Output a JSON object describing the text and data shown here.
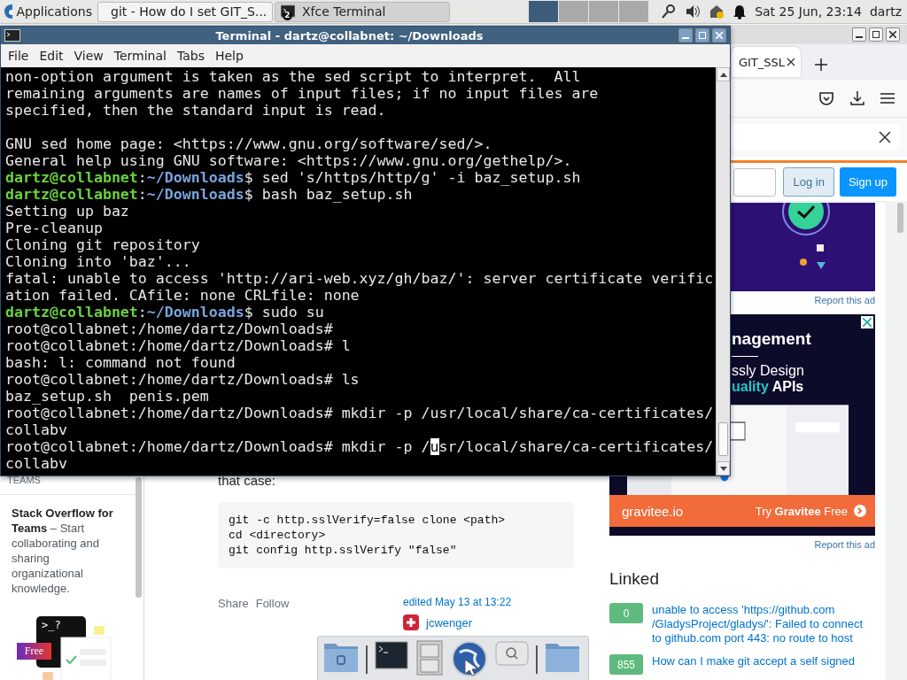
{
  "panel": {
    "app_menu": "Applications",
    "tasks": [
      {
        "kind": "browser",
        "label": "git - How do I set GIT_S...",
        "selected": false
      },
      {
        "kind": "terminal",
        "label": "Xfce Terminal",
        "badge": "2",
        "selected": true
      }
    ],
    "workspaces": [
      {
        "selected": true
      },
      {
        "selected": false
      },
      {
        "selected": false
      },
      {
        "selected": false
      }
    ],
    "clock": "Sat 25 Jun, 23:14",
    "user": "dartz"
  },
  "terminal": {
    "title": "Terminal - dartz@collabnet: ~/Downloads",
    "menu": [
      "File",
      "Edit",
      "View",
      "Terminal",
      "Tabs",
      "Help"
    ],
    "lines": [
      {
        "kind": "text",
        "text": "non-option argument is taken as the sed script to interpret.  All"
      },
      {
        "kind": "text",
        "text": "remaining arguments are names of input files; if no input files are"
      },
      {
        "kind": "text",
        "text": "specified, then the standard input is read."
      },
      {
        "kind": "blank"
      },
      {
        "kind": "text",
        "text": "GNU sed home page: <https://www.gnu.org/software/sed/>."
      },
      {
        "kind": "text",
        "text": "General help using GNU software: <https://www.gnu.org/gethelp/>."
      },
      {
        "kind": "prompt",
        "user": "dartz@collabnet",
        "sep": ":",
        "path": "~/Downloads",
        "command": "$ sed 's/https/http/g' -i baz_setup.sh"
      },
      {
        "kind": "prompt",
        "user": "dartz@collabnet",
        "sep": ":",
        "path": "~/Downloads",
        "command": "$ bash baz_setup.sh"
      },
      {
        "kind": "text",
        "text": "Setting up baz"
      },
      {
        "kind": "text",
        "text": "Pre-cleanup"
      },
      {
        "kind": "text",
        "text": "Cloning git repository"
      },
      {
        "kind": "text",
        "text": "Cloning into 'baz'..."
      },
      {
        "kind": "text",
        "text": "fatal: unable to access 'http://ari-web.xyz/gh/baz/': server certificate verific"
      },
      {
        "kind": "text",
        "text": "ation failed. CAfile: none CRLfile: none"
      },
      {
        "kind": "prompt",
        "user": "dartz@collabnet",
        "sep": ":",
        "path": "~/Downloads",
        "command": "$ sudo su"
      },
      {
        "kind": "text",
        "text": "root@collabnet:/home/dartz/Downloads#"
      },
      {
        "kind": "text",
        "text": "root@collabnet:/home/dartz/Downloads# l"
      },
      {
        "kind": "text",
        "text": "bash: l: command not found"
      },
      {
        "kind": "text",
        "text": "root@collabnet:/home/dartz/Downloads# ls"
      },
      {
        "kind": "text",
        "text": "baz_setup.sh  penis.pem"
      },
      {
        "kind": "text",
        "text": "root@collabnet:/home/dartz/Downloads# mkdir -p /usr/local/share/ca-certificates/"
      },
      {
        "kind": "text",
        "text": "collabv"
      },
      {
        "kind": "cursor",
        "before": "root@collabnet:/home/dartz/Downloads# mkdir -p /",
        "cursor": "u",
        "after": "sr/local/share/ca-certificates/"
      },
      {
        "kind": "text",
        "text": "collabv"
      }
    ]
  },
  "browser": {
    "tab": {
      "label": "GIT_SSL"
    },
    "auth": {
      "login": "Log in",
      "signup": "Sign up"
    },
    "sidebar": {
      "section": "TEAMS",
      "promo": "**Stack Overflow for Teams** – Start collaborating and sharing organizational knowledge.",
      "prompt": ">_?",
      "badge": "Free"
    },
    "answer": {
      "intro": "that case:",
      "code": [
        "git -c http.sslVerify=false clone <path>",
        "cd <directory>",
        "git config http.sslVerify \"false\""
      ],
      "actions": [
        "Share",
        "Follow"
      ],
      "edited": "edited May 13 at 13:22",
      "user": "jcwenger"
    },
    "ads": [
      {
        "kind": "picture",
        "report": "Report this ad"
      },
      {
        "kind": "banner",
        "heading": "nagement",
        "line": "ssly Design",
        "highlight": "uality",
        "rest": "APIs",
        "brand": "gravitee.io",
        "cta": "Try **Gravitee** Free",
        "report": "Report this ad"
      }
    ],
    "linked": {
      "title": "Linked",
      "items": [
        {
          "score": "0",
          "text": "unable to access 'https://github.com /GladysProject/gladys/': Failed to connect to github.com port 443: no route to host"
        },
        {
          "score": "855",
          "text": "How can I make git accept a self signed"
        }
      ]
    }
  }
}
